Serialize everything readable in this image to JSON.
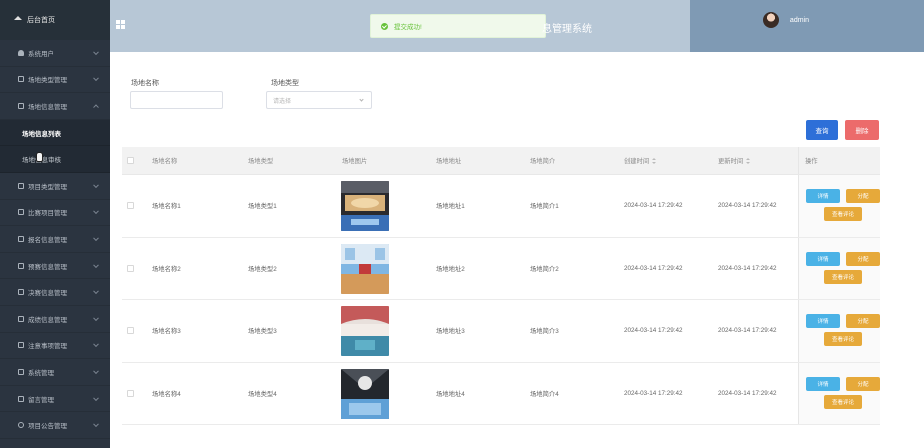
{
  "sidebar": {
    "home": "后台首页",
    "items": [
      {
        "label": "系统用户",
        "icon": "user-icon"
      },
      {
        "label": "场地类型管理",
        "icon": "doc-icon"
      },
      {
        "label": "场地信息管理",
        "icon": "doc-icon"
      }
    ],
    "subitems": [
      {
        "label": "场地信息列表",
        "active": true
      },
      {
        "label": "场地信息审核",
        "active": false
      }
    ],
    "more_items": [
      {
        "label": "项目类型管理",
        "icon": "doc-icon"
      },
      {
        "label": "比赛项目管理",
        "icon": "doc-icon"
      },
      {
        "label": "报名信息管理",
        "icon": "doc-icon"
      },
      {
        "label": "预赛信息管理",
        "icon": "doc-icon"
      },
      {
        "label": "决赛信息管理",
        "icon": "doc-icon"
      },
      {
        "label": "成绩信息管理",
        "icon": "doc-icon"
      },
      {
        "label": "注意事项管理",
        "icon": "doc-icon"
      },
      {
        "label": "系统管理",
        "icon": "monitor-icon"
      },
      {
        "label": "留言管理",
        "icon": "message-icon"
      },
      {
        "label": "项目公告管理",
        "icon": "info-icon"
      }
    ]
  },
  "header": {
    "title": "息管理系统",
    "user": "admin",
    "toast": "提交成功!"
  },
  "search": {
    "name_label": "场地名称",
    "type_label": "场地类型",
    "type_placeholder": "请选择",
    "search_btn": "查询",
    "delete_btn": "删除"
  },
  "table": {
    "columns": [
      "场地名称",
      "场地类型",
      "场地图片",
      "场地地址",
      "场地简介",
      "创建时间",
      "更新时间",
      "操作"
    ],
    "rows": [
      {
        "name": "场地名称1",
        "type": "场地类型1",
        "address": "场地地址1",
        "intro": "场地简介1",
        "created": "2024-03-14 17:29:42",
        "updated": "2024-03-14 17:29:42"
      },
      {
        "name": "场地名称2",
        "type": "场地类型2",
        "address": "场地地址2",
        "intro": "场地简介2",
        "created": "2024-03-14 17:29:42",
        "updated": "2024-03-14 17:29:42"
      },
      {
        "name": "场地名称3",
        "type": "场地类型3",
        "address": "场地地址3",
        "intro": "场地简介3",
        "created": "2024-03-14 17:29:42",
        "updated": "2024-03-14 17:29:42"
      },
      {
        "name": "场地名称4",
        "type": "场地类型4",
        "address": "场地地址4",
        "intro": "场地简介4",
        "created": "2024-03-14 17:29:42",
        "updated": "2024-03-14 17:29:42"
      }
    ],
    "ops": {
      "detail": "详情",
      "assign": "分配",
      "review": "查看评论"
    }
  }
}
